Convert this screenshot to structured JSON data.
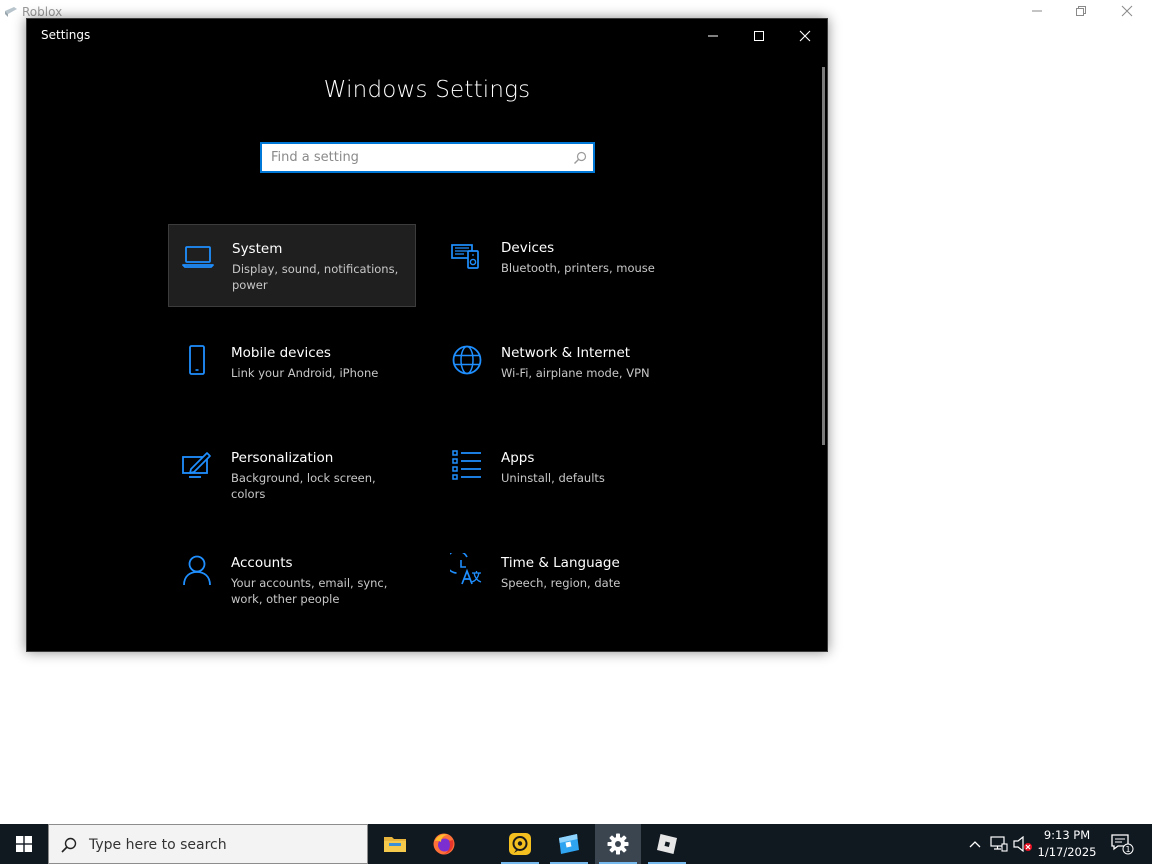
{
  "background_window": {
    "title": "Roblox"
  },
  "settings_window": {
    "app_title": "Settings",
    "page_title": "Windows Settings",
    "search": {
      "placeholder": "Find a setting",
      "value": ""
    },
    "tiles": [
      {
        "id": "system",
        "icon": "laptop-icon",
        "title": "System",
        "description": "Display, sound, notifications, power",
        "selected": true
      },
      {
        "id": "devices",
        "icon": "devices-icon",
        "title": "Devices",
        "description": "Bluetooth, printers, mouse",
        "selected": false
      },
      {
        "id": "mobile",
        "icon": "phone-icon",
        "title": "Mobile devices",
        "description": "Link your Android, iPhone",
        "selected": false
      },
      {
        "id": "network",
        "icon": "globe-icon",
        "title": "Network & Internet",
        "description": "Wi-Fi, airplane mode, VPN",
        "selected": false
      },
      {
        "id": "personalization",
        "icon": "paint-icon",
        "title": "Personalization",
        "description": "Background, lock screen, colors",
        "selected": false
      },
      {
        "id": "apps",
        "icon": "apps-list-icon",
        "title": "Apps",
        "description": "Uninstall, defaults",
        "selected": false
      },
      {
        "id": "accounts",
        "icon": "person-icon",
        "title": "Accounts",
        "description": "Your accounts, email, sync, work, other people",
        "selected": false
      },
      {
        "id": "time",
        "icon": "time-language-icon",
        "title": "Time & Language",
        "description": "Speech, region, date",
        "selected": false
      }
    ]
  },
  "taskbar": {
    "search_placeholder": "Type here to search",
    "apps": [
      {
        "id": "file-explorer",
        "icon": "folder-icon",
        "running": false,
        "active": false
      },
      {
        "id": "firefox",
        "icon": "firefox-icon",
        "running": false,
        "active": false
      },
      {
        "id": "app-yellow",
        "icon": "chat-app-icon",
        "running": true,
        "active": false
      },
      {
        "id": "roblox-studio",
        "icon": "roblox-studio-icon",
        "running": true,
        "active": false
      },
      {
        "id": "settings",
        "icon": "gear-icon",
        "running": true,
        "active": true
      },
      {
        "id": "roblox",
        "icon": "roblox-icon",
        "running": true,
        "active": false
      }
    ],
    "clock": {
      "time": "9:13 PM",
      "date": "1/17/2025"
    },
    "notification_count": "1"
  },
  "colors": {
    "accent": "#0078d7",
    "icon_blue": "#1f8fff",
    "window_bg": "#000000",
    "taskbar_bg": "#101820"
  }
}
